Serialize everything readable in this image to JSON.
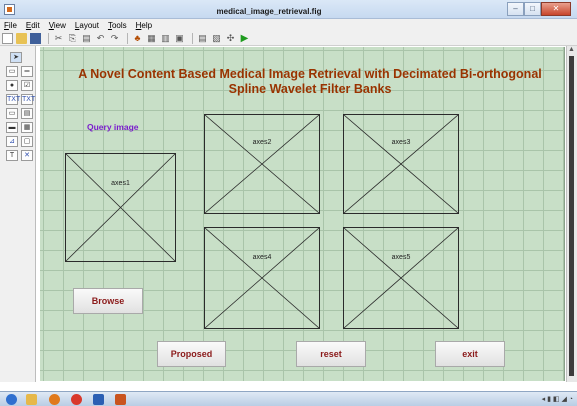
{
  "window": {
    "title": "medical_image_retrieval.fig"
  },
  "window_buttons": {
    "minimize": "–",
    "maximize": "□",
    "close": "✕"
  },
  "menu": [
    "File",
    "Edit",
    "View",
    "Layout",
    "Tools",
    "Help"
  ],
  "toolbar_icons": [
    "new-icon",
    "open-icon",
    "save-icon",
    "cut-icon",
    "copy-icon",
    "paste-icon",
    "undo-icon",
    "redo-icon",
    "align-icon",
    "menu-editor-icon",
    "tab-order-icon",
    "toolbar-editor-icon",
    "editor-icon",
    "property-inspector-icon",
    "object-browser-icon",
    "run-icon"
  ],
  "palette_icons": [
    "select-icon",
    "pushbutton-icon",
    "slider-icon",
    "radio-button-icon",
    "checkbox-icon",
    "edit-text-icon",
    "static-text-icon",
    "popup-menu-icon",
    "listbox-icon",
    "toggle-button-icon",
    "table-icon",
    "axes-icon",
    "panel-icon",
    "button-group-icon",
    "activex-icon"
  ],
  "figure": {
    "title": "A Novel Content Based Medical Image Retrieval with Decimated Bi-orthogonal Spline Wavelet Filter Banks",
    "query_label": "Query image",
    "axes": [
      "axes1",
      "axes2",
      "axes3",
      "axes4",
      "axes5"
    ],
    "buttons": {
      "browse": "Browse",
      "proposed": "Proposed",
      "reset": "reset",
      "exit": "exit"
    }
  },
  "colors": {
    "canvas": "#c8dfc7",
    "title": "#993300",
    "query_label": "#7a1ccc",
    "button_text": "#8b1a1a"
  }
}
